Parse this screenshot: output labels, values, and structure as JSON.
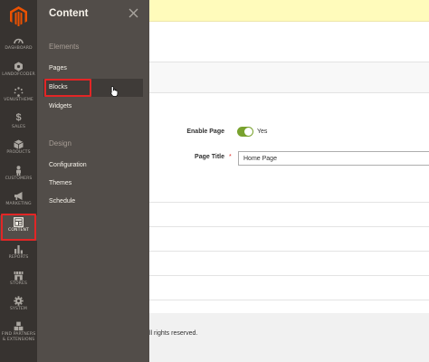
{
  "nav": {
    "items": [
      {
        "label": "DASHBOARD",
        "icon": "dashboard-icon"
      },
      {
        "label": "LANDOFCODER",
        "icon": "hexagon-icon"
      },
      {
        "label": "VENUSTHEME",
        "icon": "dots-icon"
      },
      {
        "label": "SALES",
        "icon": "dollar-icon"
      },
      {
        "label": "PRODUCTS",
        "icon": "box-icon"
      },
      {
        "label": "CUSTOMERS",
        "icon": "person-icon"
      },
      {
        "label": "MARKETING",
        "icon": "megaphone-icon"
      },
      {
        "label": "CONTENT",
        "icon": "layout-icon"
      },
      {
        "label": "REPORTS",
        "icon": "bar-chart-icon"
      },
      {
        "label": "STORES",
        "icon": "store-icon"
      },
      {
        "label": "SYSTEM",
        "icon": "gear-icon"
      },
      {
        "label_line1": "FIND PARTNERS",
        "label_line2": "& EXTENSIONS",
        "icon": "cubes-icon"
      }
    ]
  },
  "panel": {
    "title": "Content",
    "groups": [
      {
        "title": "Elements",
        "links": [
          "Pages",
          "Blocks",
          "Widgets"
        ]
      },
      {
        "title": "Design",
        "links": [
          "Configuration",
          "Themes",
          "Schedule"
        ]
      }
    ]
  },
  "form": {
    "enable_label": "Enable Page",
    "enable_value": "Yes",
    "title_label": "Page Title",
    "title_value": "Home Page"
  },
  "footer": {
    "text": "ll rights reserved."
  },
  "colors": {
    "nav_bg": "#373330",
    "panel_bg": "#524d49",
    "accent": "#eb5202",
    "highlight": "#e22626",
    "toggle_on": "#79a22e"
  }
}
